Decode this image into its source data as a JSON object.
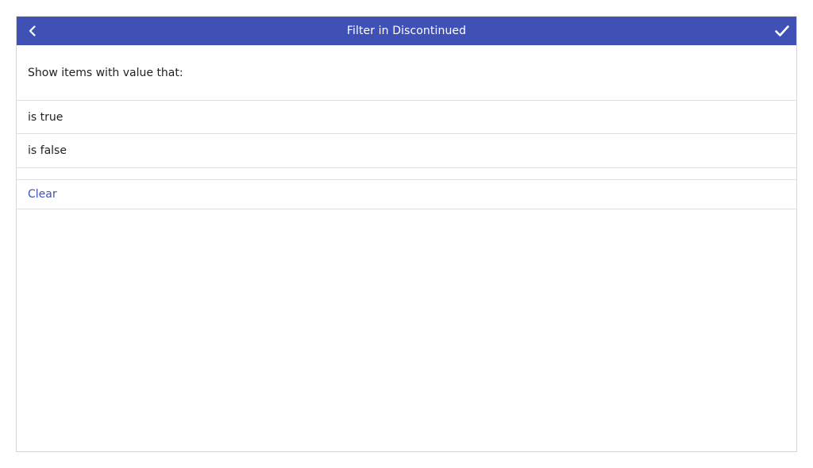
{
  "header": {
    "title": "Filter in Discontinued",
    "back_icon": "chevron-left-icon",
    "confirm_icon": "check-icon",
    "color": "#3f51b5"
  },
  "filter": {
    "prompt": "Show items with value that:",
    "options": [
      {
        "label": "is true"
      },
      {
        "label": "is false"
      }
    ],
    "clear_label": "Clear",
    "accent": "#3f51b5"
  }
}
